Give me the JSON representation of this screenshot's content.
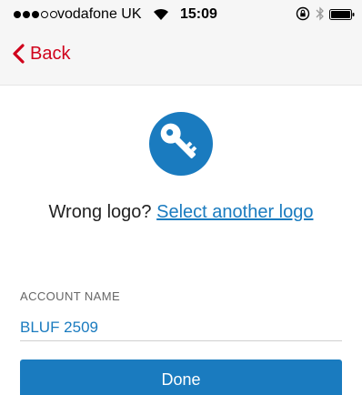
{
  "status_bar": {
    "carrier": "vodafone UK",
    "time": "15:09",
    "signal_full": 3,
    "signal_total": 5
  },
  "nav": {
    "back_label": "Back"
  },
  "logo": {
    "icon": "key-icon",
    "color": "#1a7bbf"
  },
  "logo_prompt": {
    "question": "Wrong logo?",
    "link": "Select another logo"
  },
  "form": {
    "account_label": "ACCOUNT NAME",
    "account_value": "BLUF 2509",
    "done_label": "Done"
  },
  "colors": {
    "accent": "#1a7bbf",
    "back": "#d0021b"
  }
}
